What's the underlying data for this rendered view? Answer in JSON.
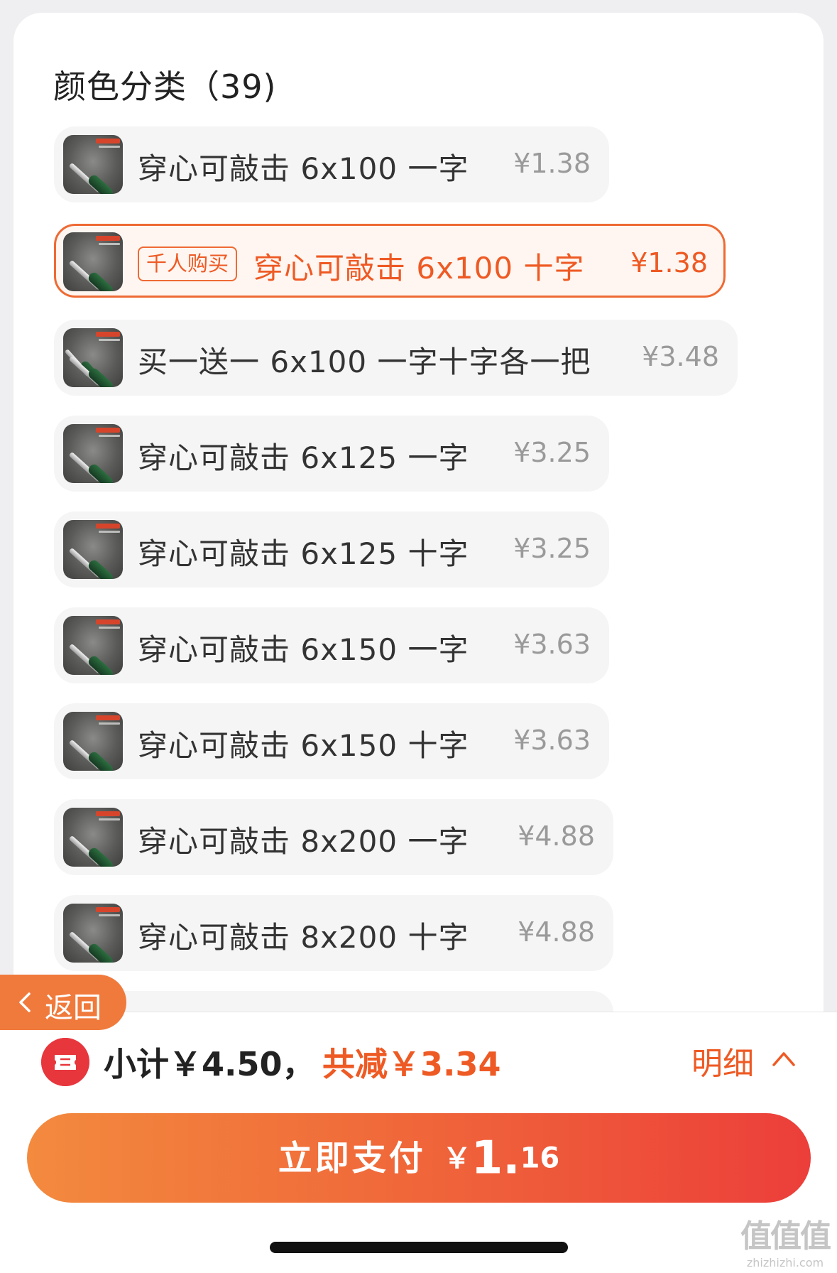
{
  "section": {
    "title": "颜色分类（39)"
  },
  "options": [
    {
      "label": "穿心可敲击 6x100 一字",
      "price": "¥1.38"
    },
    {
      "badge": "千人购买",
      "label": "穿心可敲击 6x100 十字",
      "price": "¥1.38",
      "selected": true
    },
    {
      "label": "买一送一 6x100 一字十字各一把",
      "price": "¥3.48"
    },
    {
      "label": "穿心可敲击 6x125 一字",
      "price": "¥3.25"
    },
    {
      "label": "穿心可敲击 6x125 十字",
      "price": "¥3.25"
    },
    {
      "label": "穿心可敲击 6x150 一字",
      "price": "¥3.63"
    },
    {
      "label": "穿心可敲击 6x150 十字",
      "price": "¥3.63"
    },
    {
      "label": "穿心可敲击 8x200 一字",
      "price": "¥4.88"
    },
    {
      "label": "穿心可敲击 8x200 十字",
      "price": "¥4.88"
    }
  ],
  "back": {
    "label": "返回",
    "icon": "chevron-left-icon"
  },
  "summary": {
    "subtotal": "小计￥4.50，",
    "discount": "共减￥3.34",
    "detail_label": "明细",
    "coupon_icon": "coupon-icon",
    "accent": "#ee5a24"
  },
  "pay": {
    "label": "立即支付",
    "currency": "￥",
    "amount_int": "1.",
    "amount_dec": "16"
  },
  "watermark": {
    "text": "值值值",
    "url": "zhizhizhi.com"
  }
}
